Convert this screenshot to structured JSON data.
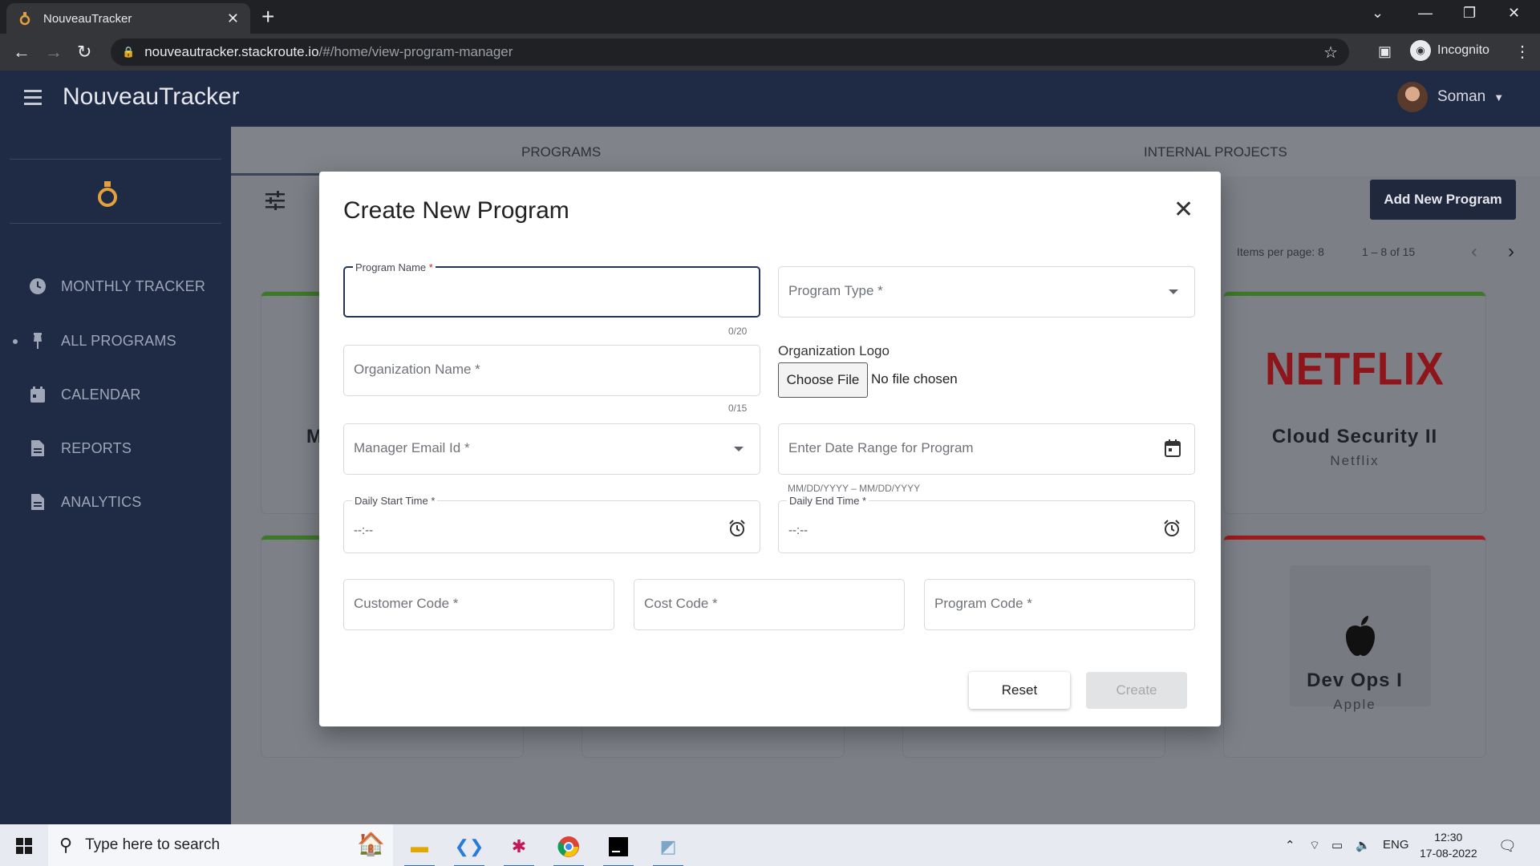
{
  "browser": {
    "tab_title": "NouveauTracker",
    "url_host": "nouveautracker.stackroute.io",
    "url_path": "/#/home/view-program-manager",
    "incognito_label": "Incognito"
  },
  "app": {
    "brand": "NouveauTracker",
    "user_name": "Soman"
  },
  "sidebar": {
    "items": [
      {
        "label": "MONTHLY TRACKER",
        "icon": "clock-icon"
      },
      {
        "label": "ALL PROGRAMS",
        "icon": "pin-icon"
      },
      {
        "label": "CALENDAR",
        "icon": "calendar-icon"
      },
      {
        "label": "REPORTS",
        "icon": "document-icon"
      },
      {
        "label": "ANALYTICS",
        "icon": "document-icon"
      }
    ]
  },
  "main": {
    "tabs": [
      "PROGRAMS",
      "INTERNAL PROJECTS"
    ],
    "add_button": "Add New Program",
    "items_per_page_label": "Items per page:",
    "items_per_page_value": "8",
    "range_label": "1 – 8 of 15",
    "partial_card_letter": "M",
    "cards": [
      {
        "title": "Cloud Security II",
        "org": "Netflix",
        "logo_text": "NETFLIX",
        "status_color": "#3b7a24"
      },
      {
        "title": "Dev Ops I",
        "org": "Apple",
        "logo_text": "",
        "status_color": "#a0191b"
      }
    ]
  },
  "dialog": {
    "title": "Create New Program",
    "program_name_label": "Program Name",
    "program_name_req": "*",
    "program_name_count": "0/20",
    "program_type_placeholder": "Program Type *",
    "organization_name_placeholder": "Organization Name *",
    "organization_name_count": "0/15",
    "organization_logo_label": "Organization Logo",
    "choose_file_label": "Choose File",
    "no_file_label": "No file chosen",
    "manager_email_placeholder": "Manager Email Id *",
    "date_range_placeholder": "Enter Date Range for Program",
    "date_range_hint": "MM/DD/YYYY – MM/DD/YYYY",
    "daily_start_label": "Daily Start Time *",
    "daily_start_value": "--:--",
    "daily_end_label": "Daily End Time *",
    "daily_end_value": "--:--",
    "customer_code_placeholder": "Customer Code *",
    "cost_code_placeholder": "Cost Code *",
    "program_code_placeholder": "Program Code *",
    "reset_label": "Reset",
    "create_label": "Create"
  },
  "taskbar": {
    "search_placeholder": "Type here to search",
    "language": "ENG",
    "time": "12:30",
    "date": "17-08-2022"
  }
}
